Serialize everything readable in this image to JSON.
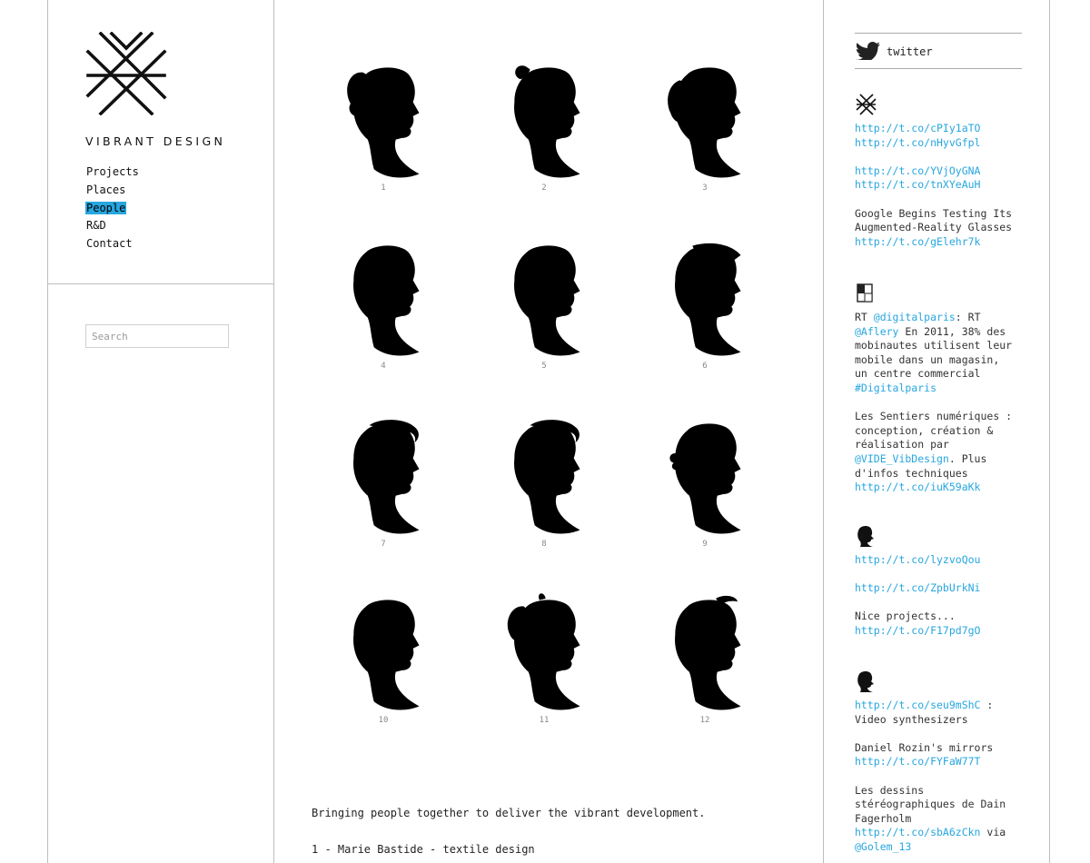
{
  "brand": {
    "name": "VIBRANT DESIGN"
  },
  "nav": [
    "Projects",
    "Places",
    "People",
    "R&D",
    "Contact"
  ],
  "active_nav": "People",
  "search": {
    "placeholder": "Search"
  },
  "portraits": [
    "1",
    "2",
    "3",
    "4",
    "5",
    "6",
    "7",
    "8",
    "9",
    "10",
    "11",
    "12"
  ],
  "main": {
    "intro": "Bringing people together to deliver the vibrant development.",
    "credit": "1 - Marie Bastide - textile design"
  },
  "twitter": {
    "label": "twitter",
    "tweets": [
      {
        "avatar": "logo-x-icon",
        "lines": [
          {
            "t": "link",
            "v": "http://t.co/cPIy1aTO"
          },
          {
            "t": "link",
            "v": "http://t.co/nHyvGfpl"
          },
          {
            "t": "gap"
          },
          {
            "t": "link",
            "v": "http://t.co/YVjOyGNA"
          },
          {
            "t": "link",
            "v": "http://t.co/tnXYeAuH"
          },
          {
            "t": "gap"
          },
          {
            "t": "text",
            "v": "Google Begins Testing Its"
          },
          {
            "t": "text",
            "v": "Augmented-Reality Glasses"
          },
          {
            "t": "link",
            "v": "http://t.co/gElehr7k"
          }
        ]
      },
      {
        "avatar": "square-logo-icon",
        "lines": [
          {
            "t": "mixed",
            "parts": [
              {
                "t": "text",
                "v": "RT "
              },
              {
                "t": "link",
                "v": "@digitalparis"
              },
              {
                "t": "text",
                "v": ": RT"
              }
            ]
          },
          {
            "t": "mixed",
            "parts": [
              {
                "t": "link",
                "v": "@Aflery"
              },
              {
                "t": "text",
                "v": " En 2011, 38% des"
              }
            ]
          },
          {
            "t": "text",
            "v": "mobinautes utilisent leur"
          },
          {
            "t": "text",
            "v": "mobile dans un magasin,"
          },
          {
            "t": "text",
            "v": "un centre commercial"
          },
          {
            "t": "link",
            "v": "#Digitalparis"
          },
          {
            "t": "gap"
          },
          {
            "t": "text",
            "v": "Les Sentiers numériques :"
          },
          {
            "t": "text",
            "v": "conception, création &"
          },
          {
            "t": "text",
            "v": "réalisation par"
          },
          {
            "t": "mixed",
            "parts": [
              {
                "t": "link",
                "v": "@VIDE_VibDesign"
              },
              {
                "t": "text",
                "v": ". Plus"
              }
            ]
          },
          {
            "t": "text",
            "v": "d'infos techniques"
          },
          {
            "t": "link",
            "v": "http://t.co/iuK59aKk"
          }
        ]
      },
      {
        "avatar": "head-silhouette-icon",
        "lines": [
          {
            "t": "link",
            "v": "http://t.co/lyzvoQou"
          },
          {
            "t": "gap"
          },
          {
            "t": "link",
            "v": "http://t.co/ZpbUrkNi"
          },
          {
            "t": "gap"
          },
          {
            "t": "text",
            "v": "Nice projects..."
          },
          {
            "t": "link",
            "v": "http://t.co/F17pd7gO"
          }
        ]
      },
      {
        "avatar": "head-silhouette-icon",
        "lines": [
          {
            "t": "mixed",
            "parts": [
              {
                "t": "link",
                "v": "http://t.co/seu9mShC"
              },
              {
                "t": "text",
                "v": " :"
              }
            ]
          },
          {
            "t": "text",
            "v": "Video synthesizers"
          },
          {
            "t": "gap"
          },
          {
            "t": "text",
            "v": "Daniel Rozin's mirrors"
          },
          {
            "t": "link",
            "v": "http://t.co/FYFaW77T"
          },
          {
            "t": "gap"
          },
          {
            "t": "text",
            "v": "Les dessins"
          },
          {
            "t": "text",
            "v": "stéréographiques de Dain"
          },
          {
            "t": "text",
            "v": "Fagerholm"
          },
          {
            "t": "mixed",
            "parts": [
              {
                "t": "link",
                "v": "http://t.co/sbA6zCkn"
              },
              {
                "t": "text",
                "v": " via"
              }
            ]
          },
          {
            "t": "link",
            "v": "@Golem_13"
          }
        ]
      }
    ]
  },
  "colors": {
    "accent": "#27a6df",
    "border": "#bdbdbd",
    "silhouette": "#000000"
  }
}
